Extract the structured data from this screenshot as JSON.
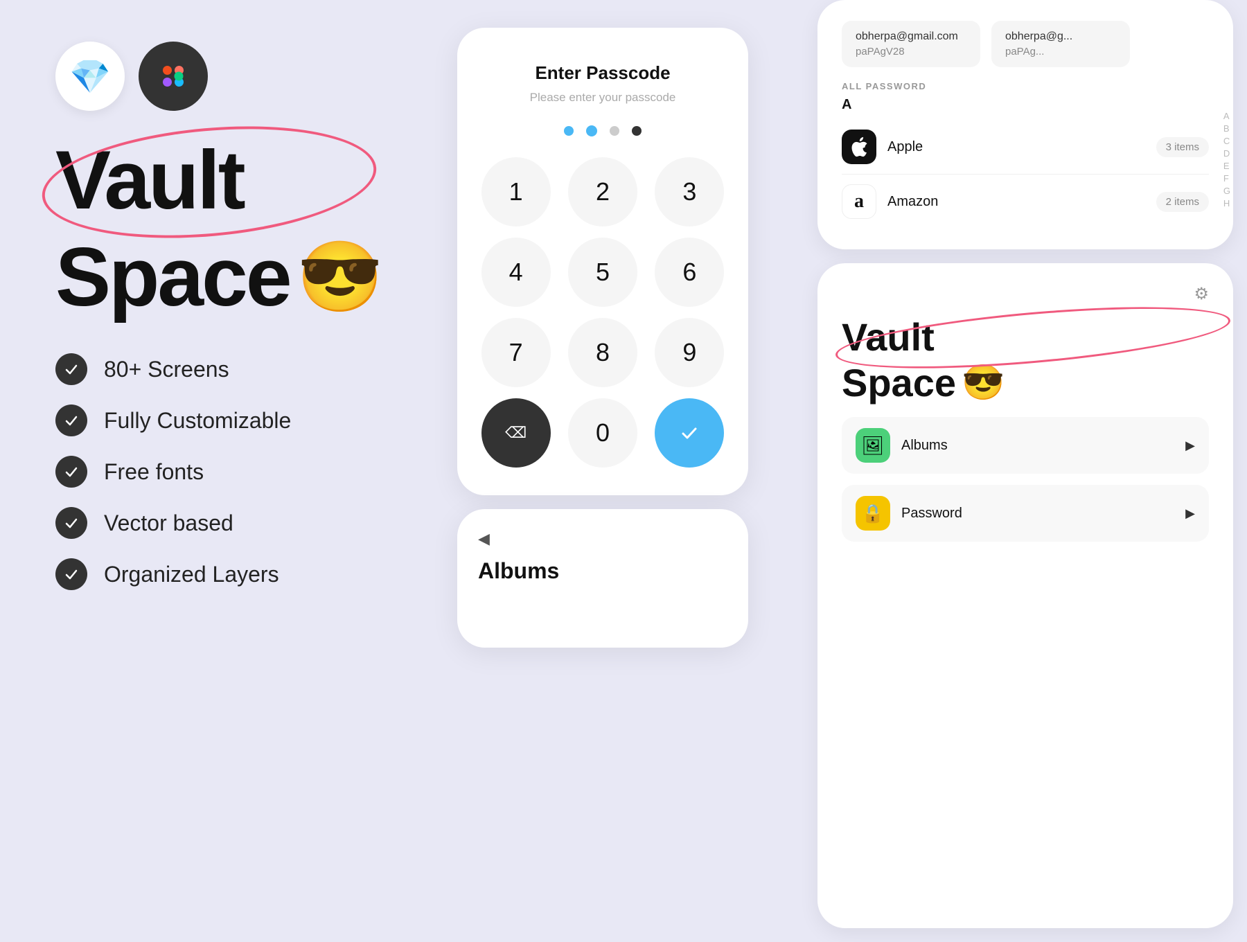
{
  "left": {
    "logos": [
      {
        "name": "sketch-logo",
        "emoji": "💎",
        "bg": "#fff"
      },
      {
        "name": "figma-logo",
        "emoji": "figma",
        "bg": "#333"
      }
    ],
    "title": {
      "vault": "Vault",
      "space": "Space",
      "emoji": "😎"
    },
    "features": [
      {
        "id": "screens",
        "label": "80+ Screens"
      },
      {
        "id": "customizable",
        "label": "Fully Customizable"
      },
      {
        "id": "fonts",
        "label": "Free fonts"
      },
      {
        "id": "vector",
        "label": "Vector based"
      },
      {
        "id": "layers",
        "label": "Organized Layers"
      }
    ]
  },
  "center": {
    "passcode": {
      "title": "Enter Passcode",
      "subtitle": "Please enter your passcode",
      "dots": [
        {
          "state": "filled"
        },
        {
          "state": "active"
        },
        {
          "state": "empty"
        },
        {
          "state": "dark"
        }
      ],
      "numpad": [
        [
          "1",
          "2",
          "3"
        ],
        [
          "4",
          "5",
          "6"
        ],
        [
          "7",
          "8",
          "9"
        ],
        [
          "del",
          "0",
          "ok"
        ]
      ]
    },
    "bottom": {
      "label": "Albums",
      "back_arrow": "◀"
    }
  },
  "right_top": {
    "emails": [
      {
        "email": "obherpa@gmail.com",
        "password": "paPAgV28"
      },
      {
        "email": "obherpa@g...",
        "password": "paPAg..."
      }
    ],
    "section_label": "ALL PASSWORD",
    "section_letter": "A",
    "alphabet_nav": [
      "A",
      "B",
      "C",
      "D",
      "E",
      "F",
      "G",
      "H"
    ],
    "items": [
      {
        "icon": "🍎",
        "name": "Apple",
        "count": "3 items",
        "icon_bg": "#111"
      },
      {
        "icon": "a",
        "name": "Amazon",
        "count": "2 items",
        "icon_bg": "#fff"
      }
    ]
  },
  "right_bottom": {
    "gear_icon": "⚙",
    "title": {
      "vault": "Vault",
      "space": "Space",
      "emoji": "😎"
    },
    "menu_items": [
      {
        "icon": "🖼",
        "label": "Albums",
        "icon_bg": "green"
      },
      {
        "icon": "🔒",
        "label": "Password",
        "icon_bg": "yellow"
      }
    ]
  }
}
